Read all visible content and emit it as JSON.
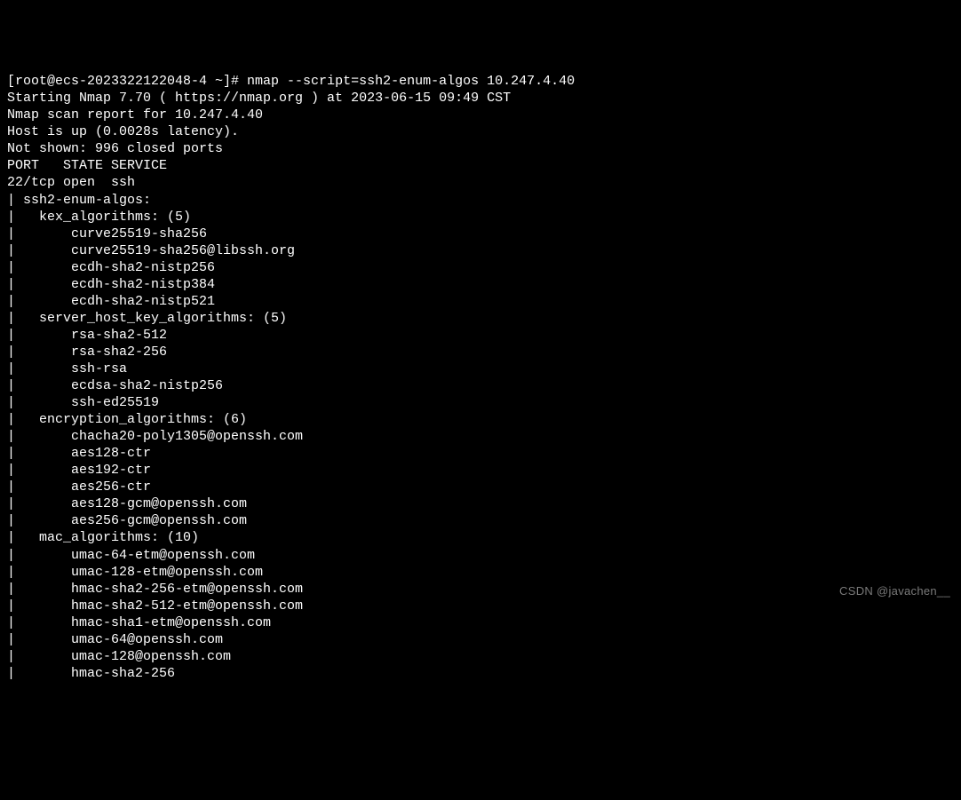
{
  "terminal": {
    "prompt": "[root@ecs-2023322122048-4 ~]# ",
    "command": "nmap --script=ssh2-enum-algos 10.247.4.40",
    "lines": [
      "Starting Nmap 7.70 ( https://nmap.org ) at 2023-06-15 09:49 CST",
      "Nmap scan report for 10.247.4.40",
      "Host is up (0.0028s latency).",
      "Not shown: 996 closed ports",
      "PORT   STATE SERVICE",
      "22/tcp open  ssh",
      "| ssh2-enum-algos:",
      "|   kex_algorithms: (5)",
      "|       curve25519-sha256",
      "|       curve25519-sha256@libssh.org",
      "|       ecdh-sha2-nistp256",
      "|       ecdh-sha2-nistp384",
      "|       ecdh-sha2-nistp521",
      "|   server_host_key_algorithms: (5)",
      "|       rsa-sha2-512",
      "|       rsa-sha2-256",
      "|       ssh-rsa",
      "|       ecdsa-sha2-nistp256",
      "|       ssh-ed25519",
      "|   encryption_algorithms: (6)",
      "|       chacha20-poly1305@openssh.com",
      "|       aes128-ctr",
      "|       aes192-ctr",
      "|       aes256-ctr",
      "|       aes128-gcm@openssh.com",
      "|       aes256-gcm@openssh.com",
      "|   mac_algorithms: (10)",
      "|       umac-64-etm@openssh.com",
      "|       umac-128-etm@openssh.com",
      "|       hmac-sha2-256-etm@openssh.com",
      "|       hmac-sha2-512-etm@openssh.com",
      "|       hmac-sha1-etm@openssh.com",
      "|       umac-64@openssh.com",
      "|       umac-128@openssh.com",
      "|       hmac-sha2-256"
    ]
  },
  "watermark": "CSDN @javachen__"
}
